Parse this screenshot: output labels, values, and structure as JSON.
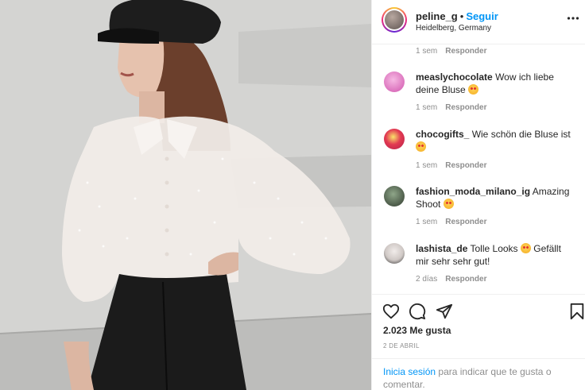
{
  "post": {
    "username": "peline_g",
    "separator": "•",
    "follow_label": "Seguir",
    "location": "Heidelberg, Germany"
  },
  "comments": {
    "top": {
      "time": "1 sem",
      "reply_label": "Responder"
    },
    "items": [
      {
        "user": "measlychocolate",
        "text": "Wow ich liebe deine Bluse",
        "emoji": "heart-eyes-emoji",
        "time": "1 sem",
        "reply_label": "Responder",
        "avatar_color": "#e87ac9"
      },
      {
        "user": "chocogifts_",
        "text": "Wie schön die Bluse ist",
        "emoji": "heart-eyes-emoji",
        "time": "1 sem",
        "reply_label": "Responder",
        "avatar_color": "#d72d5e"
      },
      {
        "user": "fashion_moda_milano_ig",
        "text": "Amazing Shoot",
        "emoji": "heart-eyes-emoji",
        "time": "1 sem",
        "reply_label": "Responder",
        "avatar_color": "#3e4a3c"
      },
      {
        "user": "lashista_de",
        "text": "Tolle Looks",
        "emoji": "heart-eyes-emoji",
        "text_after": "Gefällt mir sehr sehr gut!",
        "time": "2 días",
        "reply_label": "Responder",
        "avatar_color": "#d8d4d2"
      }
    ]
  },
  "actions": {
    "like_icon": "heart-icon",
    "comment_icon": "comment-icon",
    "share_icon": "share-icon",
    "save_icon": "bookmark-icon",
    "likes_text": "2.023 Me gusta",
    "date": "2 DE ABRIL"
  },
  "login_prompt": {
    "link": "Inicia sesión",
    "text": "para indicar que te gusta o comentar."
  },
  "colors": {
    "accent": "#0095f6",
    "muted": "#8e8e8e",
    "text": "#262626"
  }
}
